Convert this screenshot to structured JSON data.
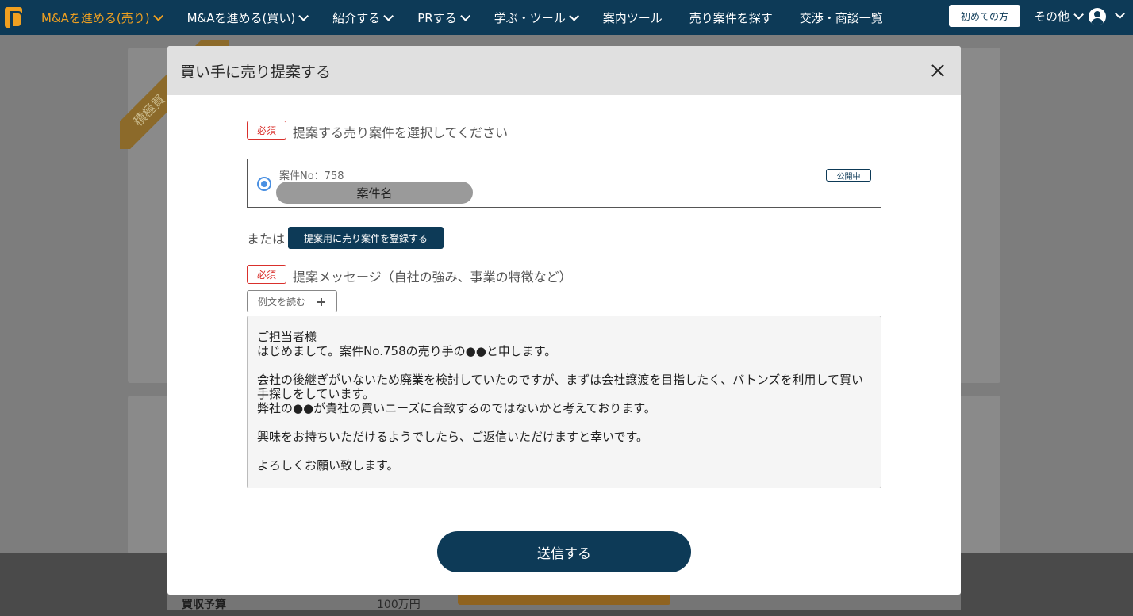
{
  "nav": {
    "items": [
      {
        "label": "M&Aを進める(売り)",
        "dropdown": true,
        "active": true
      },
      {
        "label": "M&Aを進める(買い)",
        "dropdown": true,
        "active": false
      },
      {
        "label": "紹介する",
        "dropdown": true,
        "active": false
      },
      {
        "label": "PRする",
        "dropdown": true,
        "active": false
      },
      {
        "label": "学ぶ・ツール",
        "dropdown": true,
        "active": false
      },
      {
        "label": "案内ツール",
        "dropdown": false,
        "active": false
      },
      {
        "label": "売り案件を探す",
        "dropdown": false,
        "active": false
      },
      {
        "label": "交渉・商談一覧",
        "dropdown": false,
        "active": false
      }
    ],
    "first_time_label": "初めての方",
    "other_label": "その他",
    "accent_color": "#f0a020",
    "bg_color": "#0d3a57"
  },
  "background": {
    "ribbon_text": "積極買",
    "table_key": "買収予算",
    "table_value": "100万円"
  },
  "modal": {
    "title": "買い手に売り提案する",
    "required_label": "必須",
    "select_label": "提案する売り案件を選択してください",
    "proposal": {
      "case_no": "案件No：758",
      "case_name": "案件名",
      "status": "公開中",
      "selected": true
    },
    "or_text": "または",
    "register_button": "提案用に売り案件を登録する",
    "message_label": "提案メッセージ（自社の強み、事業の特徴など）",
    "example_button": "例文を読む",
    "message_lines": [
      "ご担当者様",
      "はじめまして。案件No.758の売り手の●●と申します。",
      "",
      "会社の後継ぎがいないため廃業を検討していたのですが、まずは会社譲渡を目指したく、バトンズを利用して買い手探しをしています。",
      "弊社の●●が貴社の買いニーズに合致するのではないかと考えております。",
      "",
      "興味をお持ちいただけるようでしたら、ご返信いただけますと幸いです。",
      "",
      " よろしくお願い致します。"
    ],
    "submit_button": "送信する"
  }
}
